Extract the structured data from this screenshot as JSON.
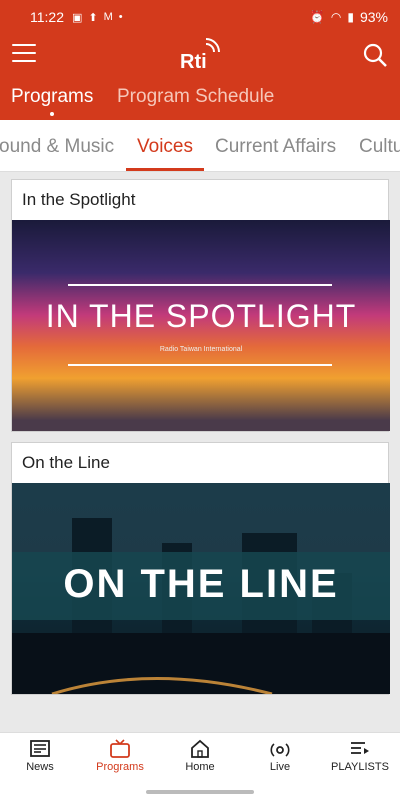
{
  "status": {
    "time": "11:22",
    "battery": "93%",
    "left_icons": [
      "image-icon",
      "upload-icon",
      "gmail-icon",
      "dot-icon"
    ],
    "right_icons": [
      "alarm-icon",
      "wifi-icon",
      "signal-icon"
    ]
  },
  "appbar": {
    "logo_text": "Rti"
  },
  "top_tabs": [
    {
      "label": "Programs",
      "active": true
    },
    {
      "label": "Program Schedule",
      "active": false
    }
  ],
  "sub_tabs": [
    {
      "label": "ound & Music",
      "active": false
    },
    {
      "label": "Voices",
      "active": true
    },
    {
      "label": "Current Affairs",
      "active": false
    },
    {
      "label": "Cultu",
      "active": false
    }
  ],
  "cards": [
    {
      "title": "In the Spotlight",
      "image_title": "IN THE SPOTLIGHT",
      "image_subtitle": "Radio Taiwan International"
    },
    {
      "title": "On the Line",
      "image_title": "ON THE LINE"
    }
  ],
  "bottom_nav": [
    {
      "label": "News",
      "icon": "news-icon",
      "active": false
    },
    {
      "label": "Programs",
      "icon": "tv-icon",
      "active": true
    },
    {
      "label": "Home",
      "icon": "home-icon",
      "active": false
    },
    {
      "label": "Live",
      "icon": "broadcast-icon",
      "active": false
    },
    {
      "label": "PLAYLISTS",
      "icon": "playlist-icon",
      "active": false
    }
  ],
  "colors": {
    "brand": "#d33a1c"
  }
}
